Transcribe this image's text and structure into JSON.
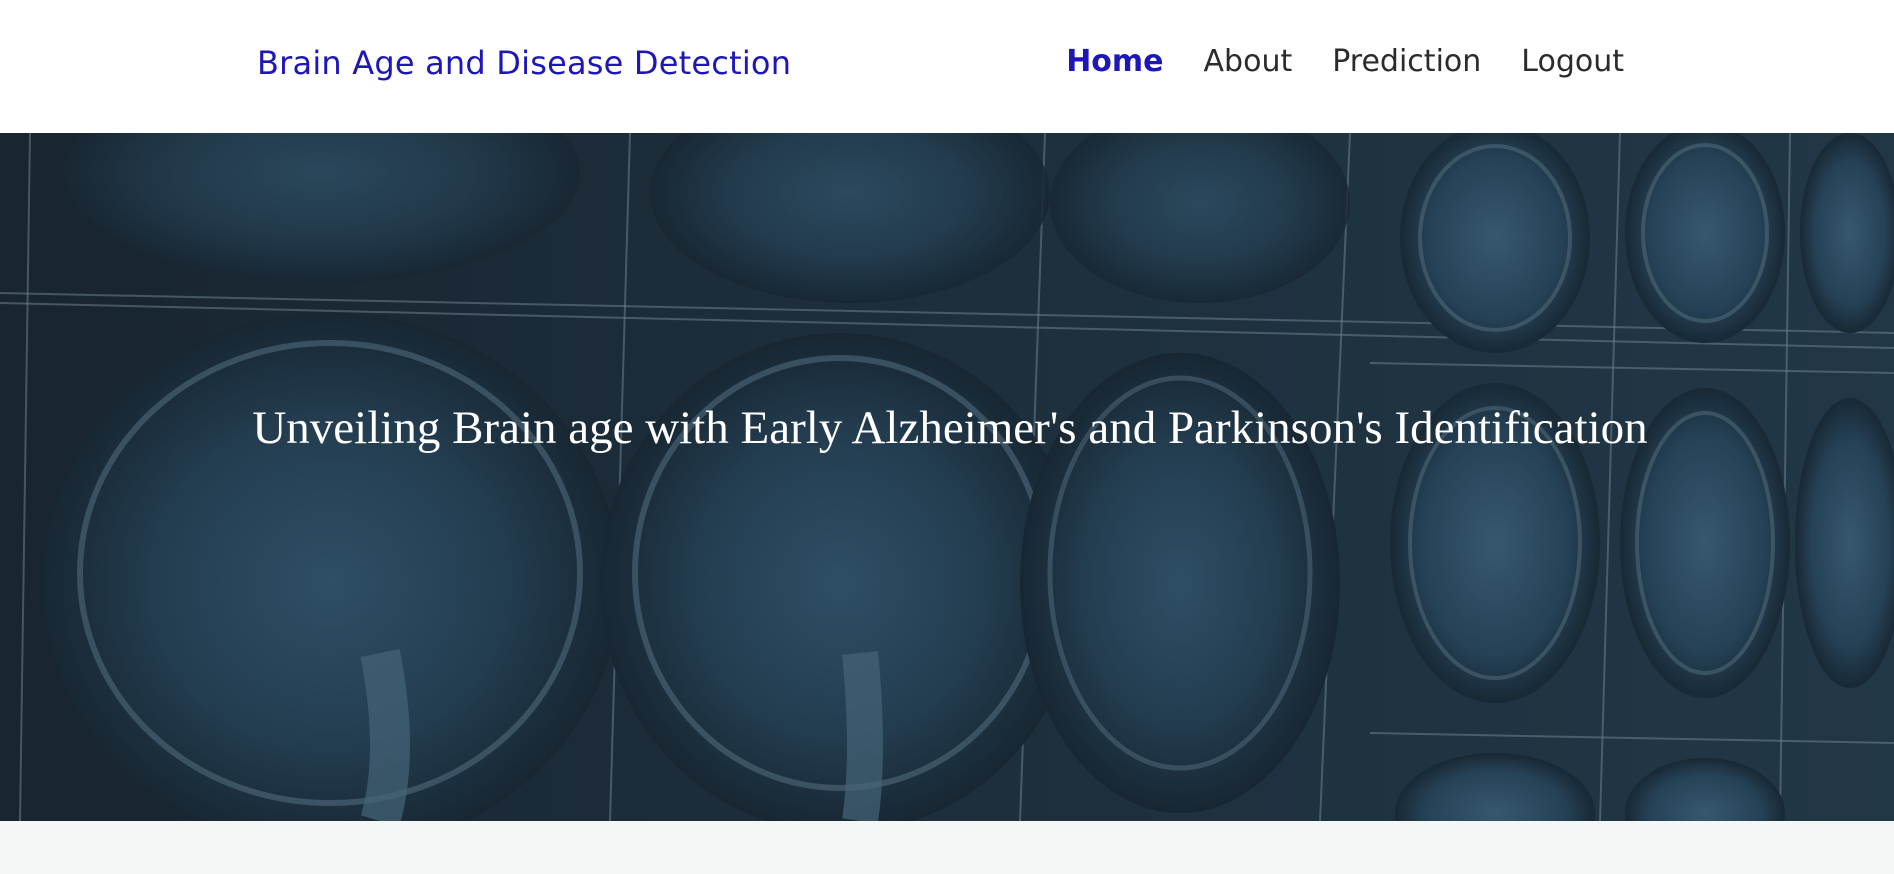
{
  "nav": {
    "brand": "Brain Age and Disease Detection",
    "links": [
      {
        "label": "Home",
        "active": true
      },
      {
        "label": "About",
        "active": false
      },
      {
        "label": "Prediction",
        "active": false
      },
      {
        "label": "Logout",
        "active": false
      }
    ]
  },
  "hero": {
    "title": "Unveiling Brain age with Early Alzheimer's and Parkinson's Identification",
    "background_image": "brain-mri-scans"
  },
  "colors": {
    "brand": "#1d17b8",
    "nav_text": "#2b2b2b",
    "hero_tint": "#1f3442",
    "page_bg": "#f3f7f5"
  }
}
